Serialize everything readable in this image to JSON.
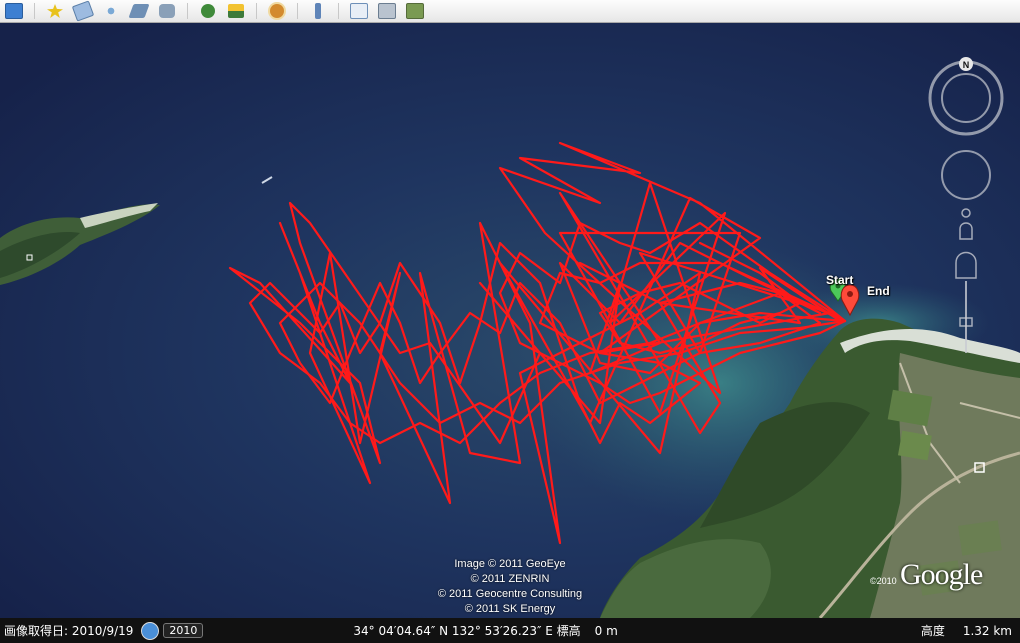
{
  "toolbar": {
    "buttons": [
      {
        "name": "sidebar-toggle-icon",
        "color": "#3d7fd1"
      },
      {
        "name": "add-placemark-icon",
        "color": "#e8c21c"
      },
      {
        "name": "add-polygon-icon",
        "color": "#7aa9d6"
      },
      {
        "name": "add-path-icon",
        "color": "#7aa9d6"
      },
      {
        "name": "add-image-overlay-icon",
        "color": "#6e8fb5"
      },
      {
        "name": "record-tour-icon",
        "color": "#8aa0b8"
      },
      {
        "name": "historical-imagery-icon",
        "color": "#3f8a3a"
      },
      {
        "name": "sunlight-icon",
        "color": "#e8a11c"
      },
      {
        "name": "switch-to-planets-icon",
        "color": "#d38a2e"
      },
      {
        "name": "ruler-icon",
        "color": "#5e84b8"
      },
      {
        "name": "email-icon",
        "color": "#6d8fb8"
      },
      {
        "name": "print-icon",
        "color": "#6b7d90"
      },
      {
        "name": "save-image-icon",
        "color": "#7a9a52"
      }
    ]
  },
  "map": {
    "start_label": "Start",
    "end_label": "End",
    "credits": [
      "Image © 2011 GeoEye",
      "© 2011 ZENRIN",
      "© 2011 Geocentre Consulting",
      "© 2011 SK Energy"
    ],
    "year_mark": "©2010",
    "logo_text": "Google",
    "track_color": "#ff1a1a"
  },
  "nav": {
    "north_label": "N"
  },
  "statusbar": {
    "imagery_date": "画像取得日: 2010/9/19",
    "year": "2010",
    "coordinates": "34° 04′04.64″ N 132° 53′26.23″ E 標高",
    "elevation": "0 m",
    "altitude_label": "高度",
    "altitude": "1.32 km"
  }
}
